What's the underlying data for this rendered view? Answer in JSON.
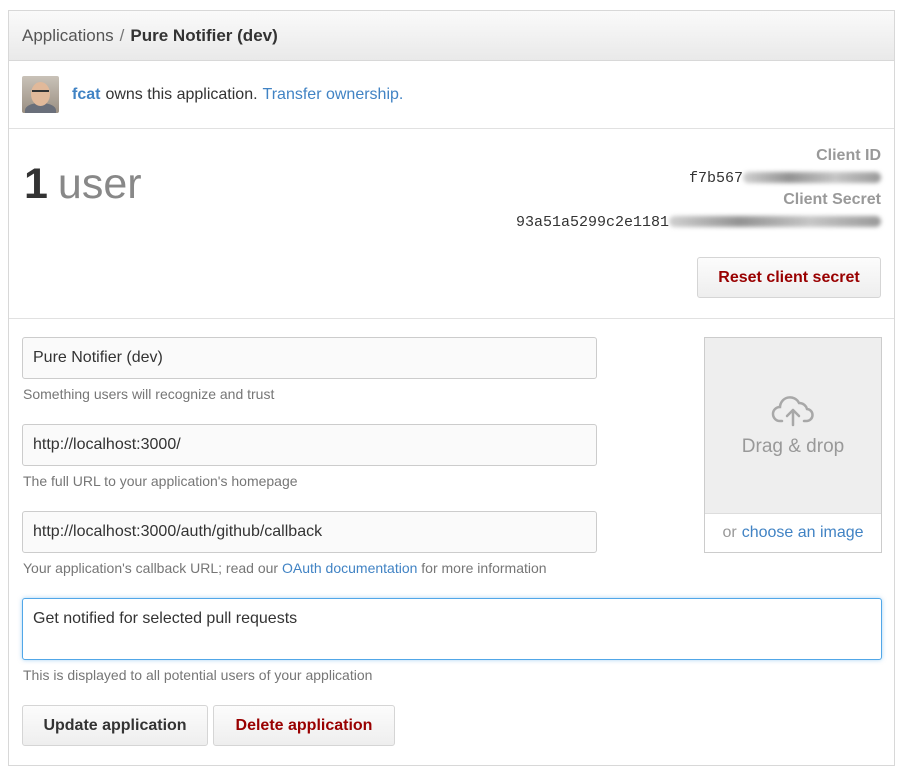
{
  "breadcrumb": {
    "parent": "Applications",
    "separator": "/",
    "current": "Pure Notifier (dev)"
  },
  "owner": {
    "username": "fcat",
    "text": "owns this application.",
    "transfer_link": "Transfer ownership."
  },
  "stats": {
    "user_count": "1",
    "user_unit": "user"
  },
  "credentials": {
    "client_id_label": "Client ID",
    "client_id_value": "f7b567",
    "client_secret_label": "Client Secret",
    "client_secret_value": "93a51a5299c2e1181",
    "reset_button": "Reset client secret"
  },
  "form": {
    "name_value": "Pure Notifier (dev)",
    "name_hint": "Something users will recognize and trust",
    "homepage_value": "http://localhost:3000/",
    "homepage_hint": "The full URL to your application's homepage",
    "callback_value": "http://localhost:3000/auth/github/callback",
    "callback_hint_pre": "Your application's callback URL; read our",
    "callback_hint_link": "OAuth documentation",
    "callback_hint_post": "for more information",
    "description_value": "Get notified for selected pull requests",
    "description_hint": "This is displayed to all potential users of your application"
  },
  "dropzone": {
    "text": "Drag & drop",
    "or_text": "or",
    "choose_link": "choose an image"
  },
  "actions": {
    "update_label": "Update application",
    "delete_label": "Delete application"
  },
  "colors": {
    "link": "#4183c4",
    "danger": "#990000",
    "focus": "#51a7e8"
  }
}
